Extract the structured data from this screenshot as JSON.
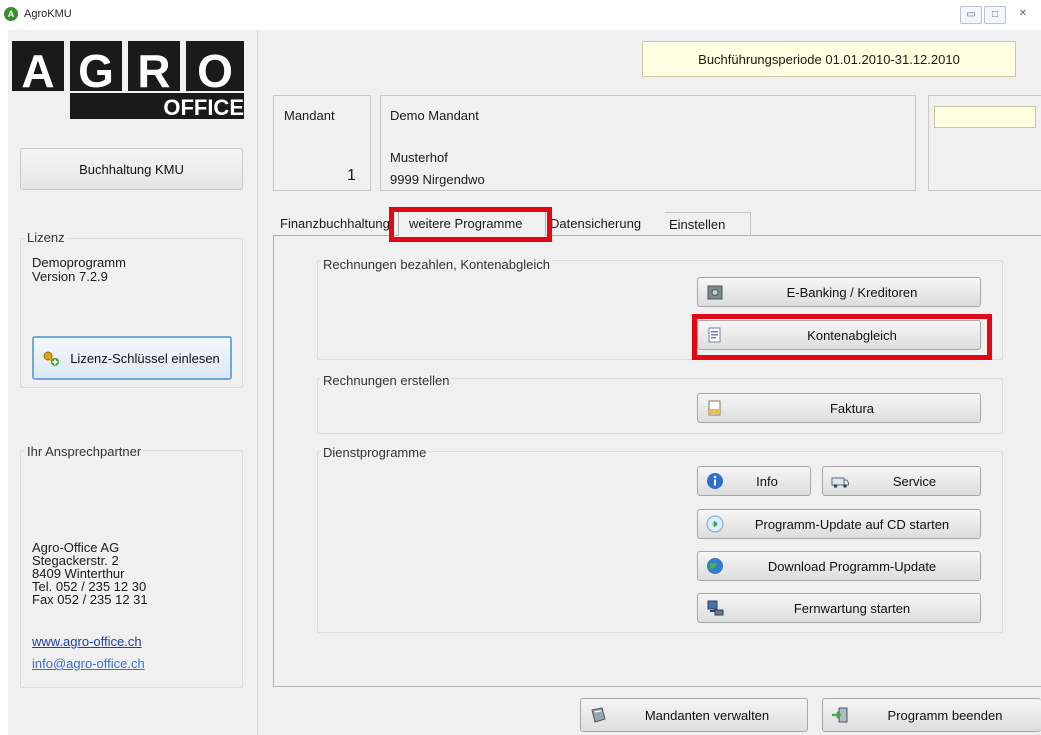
{
  "window": {
    "title": "AgroKMU",
    "app_icon_letter": "A"
  },
  "logo": {
    "letters": [
      "A",
      "G",
      "R",
      "O"
    ],
    "subtitle": "OFFICE"
  },
  "sidebar": {
    "module_button": "Buchhaltung KMU",
    "license": {
      "title": "Lizenz",
      "line1": "Demoprogramm",
      "line2": "Version 7.2.9",
      "key_button": "Lizenz-Schlüssel einlesen"
    },
    "contact": {
      "title": "Ihr Ansprechpartner",
      "lines": [
        "Agro-Office AG",
        "Stegackerstr. 2",
        "8409 Winterthur",
        "Tel. 052 / 235 12 30",
        "Fax 052 / 235 12 31"
      ],
      "website": "www.agro-office.ch",
      "email": "info@agro-office.ch"
    }
  },
  "header": {
    "period": "Buchführungsperiode 01.01.2010-31.12.2010",
    "mandant_label": "Mandant",
    "mandant_number": "1",
    "mandant_name": "Demo Mandant",
    "farm": "Musterhof",
    "address": "9999 Nirgendwo"
  },
  "tabs": [
    {
      "label": "Finanzbuchhaltung",
      "active": false
    },
    {
      "label": "weitere Programme",
      "active": true
    },
    {
      "label": "Datensicherung",
      "active": false
    },
    {
      "label": "Einstellen",
      "active": false
    }
  ],
  "groups": {
    "payments": {
      "title": "Rechnungen bezahlen, Kontenabgleich",
      "ebanking": "E-Banking / Kreditoren",
      "reconcile": "Kontenabgleich"
    },
    "invoices": {
      "title": "Rechnungen erstellen",
      "faktura": "Faktura"
    },
    "utilities": {
      "title": "Dienstprogramme",
      "info": "Info",
      "service": "Service",
      "update_cd": "Programm-Update auf CD starten",
      "download": "Download Programm-Update",
      "remote": "Fernwartung starten"
    }
  },
  "footer": {
    "manage": "Mandanten verwalten",
    "exit": "Programm beenden"
  },
  "colors": {
    "highlight": "#e40613",
    "period_bg": "#ffffe1",
    "logo_dark": "#1a1a1a"
  }
}
